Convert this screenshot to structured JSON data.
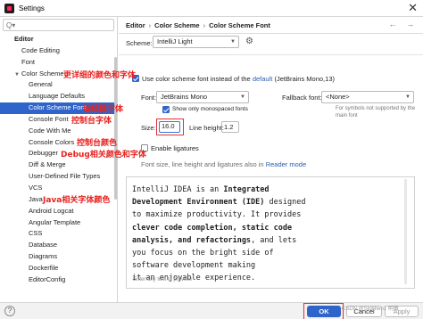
{
  "window": {
    "title": "Settings",
    "close_glyph": "✕"
  },
  "search": {
    "placeholder": "Q▾"
  },
  "sidebar": {
    "items": [
      {
        "label": "Editor",
        "level": 0
      },
      {
        "label": "Code Editing",
        "level": 1
      },
      {
        "label": "Font",
        "level": 1
      },
      {
        "label": "Color Scheme",
        "level": 1,
        "expanded": true
      },
      {
        "label": "General",
        "level": 2
      },
      {
        "label": "Language Defaults",
        "level": 2
      },
      {
        "label": "Color Scheme Font",
        "level": 2,
        "selected": true
      },
      {
        "label": "Console Font",
        "level": 2
      },
      {
        "label": "Code With Me",
        "level": 2
      },
      {
        "label": "Console Colors",
        "level": 2
      },
      {
        "label": "Debugger",
        "level": 2
      },
      {
        "label": "Diff & Merge",
        "level": 2
      },
      {
        "label": "User-Defined File Types",
        "level": 2
      },
      {
        "label": "VCS",
        "level": 2
      },
      {
        "label": "Java",
        "level": 2
      },
      {
        "label": "Android Logcat",
        "level": 2
      },
      {
        "label": "Angular Template",
        "level": 2
      },
      {
        "label": "CSS",
        "level": 2
      },
      {
        "label": "Database",
        "level": 2
      },
      {
        "label": "Diagrams",
        "level": 2
      },
      {
        "label": "Dockerfile",
        "level": 2
      },
      {
        "label": "EditorConfig",
        "level": 2
      }
    ]
  },
  "breadcrumb": {
    "parts": [
      "Editor",
      "Color Scheme",
      "Color Scheme Font"
    ],
    "sep": "›"
  },
  "nav": {
    "back_forward": "← →"
  },
  "scheme": {
    "label": "Scheme:",
    "value": "IntelliJ Light"
  },
  "use_scheme_font": {
    "checked": true,
    "text_before": "Use color scheme font instead of the",
    "link": "default",
    "text_after": "(JetBrains Mono,13)"
  },
  "font": {
    "label": "Font:",
    "value": "JetBrains Mono"
  },
  "fallback_font": {
    "label": "Fallback font:",
    "value": "<None>",
    "note": "For symbols not supported by the main font"
  },
  "monospaced": {
    "checked": true,
    "label": "Show only monospaced fonts"
  },
  "size": {
    "label": "Size:",
    "value": "16.0"
  },
  "line_height": {
    "label": "Line height:",
    "value": "1.2"
  },
  "ligatures": {
    "checked": false,
    "label": "Enable ligatures"
  },
  "ligature_hint": {
    "text": "Font size, line height and ligatures also in",
    "link": "Reader mode"
  },
  "preview": {
    "lines": [
      [
        {
          "t": "IntelliJ IDEA is an "
        },
        {
          "t": "Integrated",
          "b": true
        }
      ],
      [
        {
          "t": "Development Environment (IDE)",
          "b": true
        },
        {
          "t": " designed"
        }
      ],
      [
        {
          "t": "to maximize productivity. It provides"
        }
      ],
      [
        {
          "t": "clever code completion, static code",
          "b": true
        }
      ],
      [
        {
          "t": "analysis, and refactorings",
          "b": true
        },
        {
          "t": ", and lets"
        }
      ],
      [
        {
          "t": "you focus on the bright side of"
        }
      ],
      [
        {
          "t": "software development making"
        }
      ],
      [
        {
          "t": "it an enjoyable experience."
        }
      ]
    ],
    "hint": "Enter any text to preview"
  },
  "buttons": {
    "help": "?",
    "ok": "OK",
    "cancel": "Cancel",
    "apply": "Apply"
  },
  "watermark": "CSDN @Slobhen1 明薇",
  "annotations": {
    "color_scheme": "更详细的颜色和字体",
    "color_scheme_font": "编辑器字体",
    "console_font": "控制台字体",
    "console_colors": "控制台颜色",
    "debugger": "Debug相关颜色和字体",
    "java": "Java相关字体颜色"
  },
  "colors": {
    "accent": "#2f65ca",
    "annotation": "#e8231f",
    "link": "#2a5db0"
  }
}
